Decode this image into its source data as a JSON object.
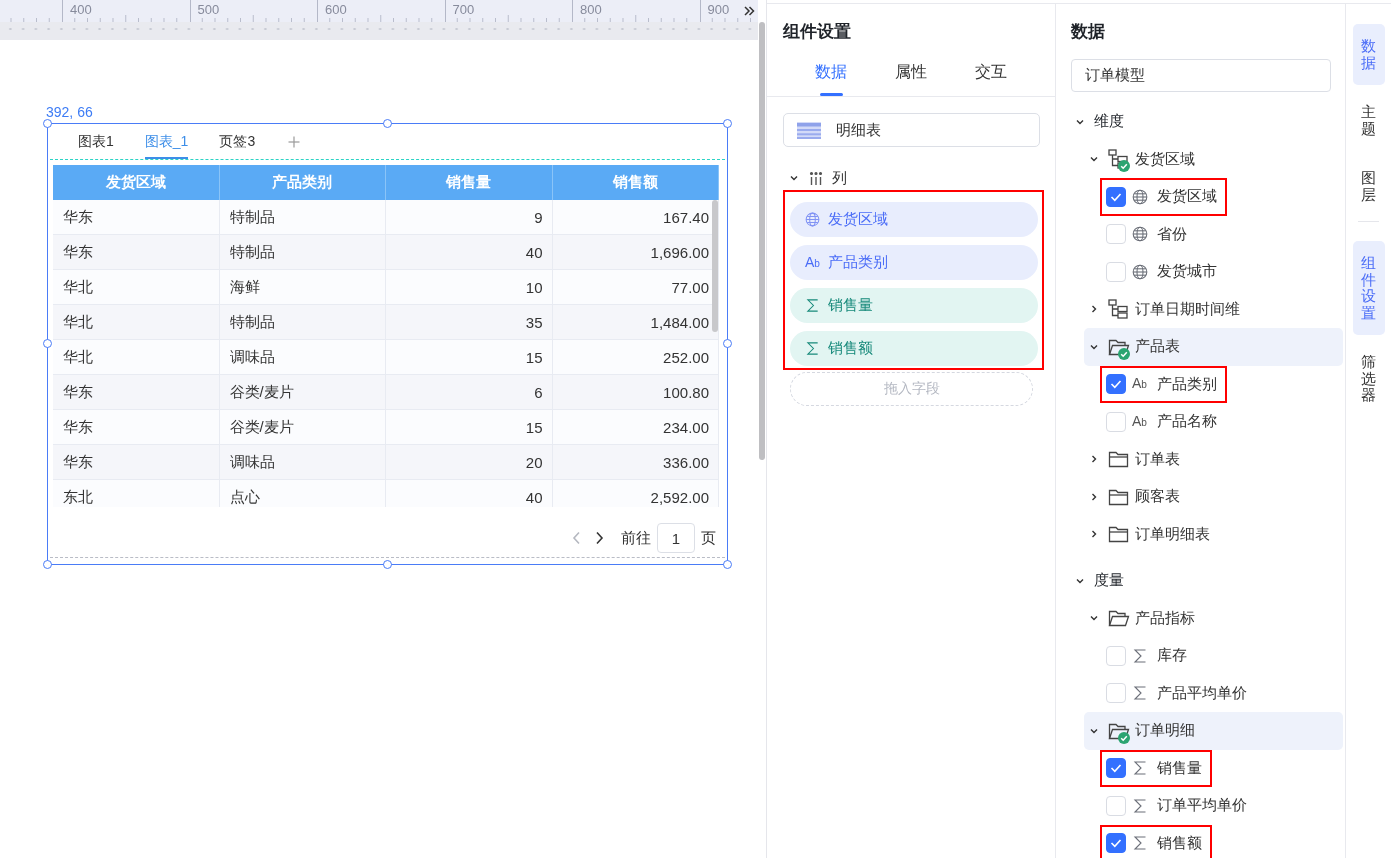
{
  "ruler": {
    "ticks": [
      "400",
      "500",
      "600",
      "700",
      "800",
      "900"
    ]
  },
  "canvas": {
    "position": "392, 66",
    "widget": {
      "tabs": [
        {
          "label": "图表1",
          "selected": false
        },
        {
          "label": "图表_1",
          "selected": true
        },
        {
          "label": "页签3",
          "selected": false
        }
      ],
      "table": {
        "columns": [
          {
            "label": "发货区域",
            "kind": "dimension"
          },
          {
            "label": "产品类别",
            "kind": "dimension"
          },
          {
            "label": "销售量",
            "kind": "measure"
          },
          {
            "label": "销售额",
            "kind": "measure"
          }
        ],
        "rows": [
          [
            "华东",
            "特制品",
            "9",
            "167.40"
          ],
          [
            "华东",
            "特制品",
            "40",
            "1,696.00"
          ],
          [
            "华北",
            "海鲜",
            "10",
            "77.00"
          ],
          [
            "华北",
            "特制品",
            "35",
            "1,484.00"
          ],
          [
            "华北",
            "调味品",
            "15",
            "252.00"
          ],
          [
            "华东",
            "谷类/麦片",
            "6",
            "100.80"
          ],
          [
            "华东",
            "谷类/麦片",
            "15",
            "234.00"
          ],
          [
            "华东",
            "调味品",
            "20",
            "336.00"
          ],
          [
            "东北",
            "点心",
            "40",
            "2,592.00"
          ]
        ]
      },
      "pagination": {
        "prev_disabled": true,
        "next_disabled": false,
        "goto_label": "前往",
        "page": "1",
        "page_suffix": "页"
      }
    }
  },
  "component_settings": {
    "title": "组件设置",
    "tabs": [
      {
        "label": "数据",
        "selected": true
      },
      {
        "label": "属性",
        "selected": false
      },
      {
        "label": "交互",
        "selected": false
      }
    ],
    "chart_type": "明细表",
    "column_section": {
      "label": "列",
      "expanded": true,
      "marked": true,
      "fields": [
        {
          "label": "发货区域",
          "kind": "geo"
        },
        {
          "label": "产品类别",
          "kind": "text",
          "type_mark": "A$_{b}$"
        },
        {
          "label": "销售量",
          "kind": "measure"
        },
        {
          "label": "销售额",
          "kind": "measure"
        }
      ],
      "drop_placeholder": "拖入字段"
    }
  },
  "data_panel": {
    "title": "数据",
    "model": "订单模型",
    "groups": [
      {
        "label": "维度",
        "expanded": true,
        "children": [
          {
            "label": "发货区域",
            "kind": "hierarchy",
            "expanded": true,
            "in_use": true,
            "selected": false,
            "children": [
              {
                "label": "发货区域",
                "kind": "geo",
                "checked": true,
                "marked": true
              },
              {
                "label": "省份",
                "kind": "geo",
                "checked": false,
                "marked": false
              },
              {
                "label": "发货城市",
                "kind": "geo",
                "checked": false,
                "marked": false
              }
            ]
          },
          {
            "label": "订单日期时间维",
            "kind": "hierarchy",
            "expanded": false,
            "in_use": false,
            "selected": false
          },
          {
            "label": "产品表",
            "kind": "folder",
            "expanded": true,
            "in_use": true,
            "selected": true,
            "children": [
              {
                "label": "产品类别",
                "kind": "text",
                "type_mark": "A$_{b}$",
                "checked": true,
                "marked": true
              },
              {
                "label": "产品名称",
                "kind": "text",
                "type_mark": "A$_{b}$",
                "checked": false,
                "marked": false
              }
            ]
          },
          {
            "label": "订单表",
            "kind": "folder",
            "expanded": false,
            "in_use": false,
            "selected": false
          },
          {
            "label": "顾客表",
            "kind": "folder",
            "expanded": false,
            "in_use": false,
            "selected": false
          },
          {
            "label": "订单明细表",
            "kind": "folder",
            "expanded": false,
            "in_use": false,
            "selected": false
          }
        ]
      },
      {
        "label": "度量",
        "expanded": true,
        "children": [
          {
            "label": "产品指标",
            "kind": "folder",
            "expanded": true,
            "in_use": false,
            "selected": false,
            "children": [
              {
                "label": "库存",
                "kind": "measure",
                "checked": false,
                "marked": false
              },
              {
                "label": "产品平均单价",
                "kind": "measure",
                "checked": false,
                "marked": false
              }
            ]
          },
          {
            "label": "订单明细",
            "kind": "folder",
            "expanded": true,
            "in_use": true,
            "selected": true,
            "children": [
              {
                "label": "销售量",
                "kind": "measure",
                "checked": true,
                "marked": true
              },
              {
                "label": "订单平均单价",
                "kind": "measure",
                "checked": false,
                "marked": false
              },
              {
                "label": "销售额",
                "kind": "measure",
                "checked": true,
                "marked": true
              }
            ]
          }
        ]
      }
    ]
  },
  "side_tab_groups": [
    [
      {
        "label": "数据",
        "selected": true
      },
      {
        "label": "主题",
        "selected": false
      },
      {
        "label": "图层",
        "selected": false
      }
    ],
    [
      {
        "label": "组件设置",
        "selected": true
      },
      {
        "label": "筛选器",
        "selected": false
      }
    ]
  ]
}
